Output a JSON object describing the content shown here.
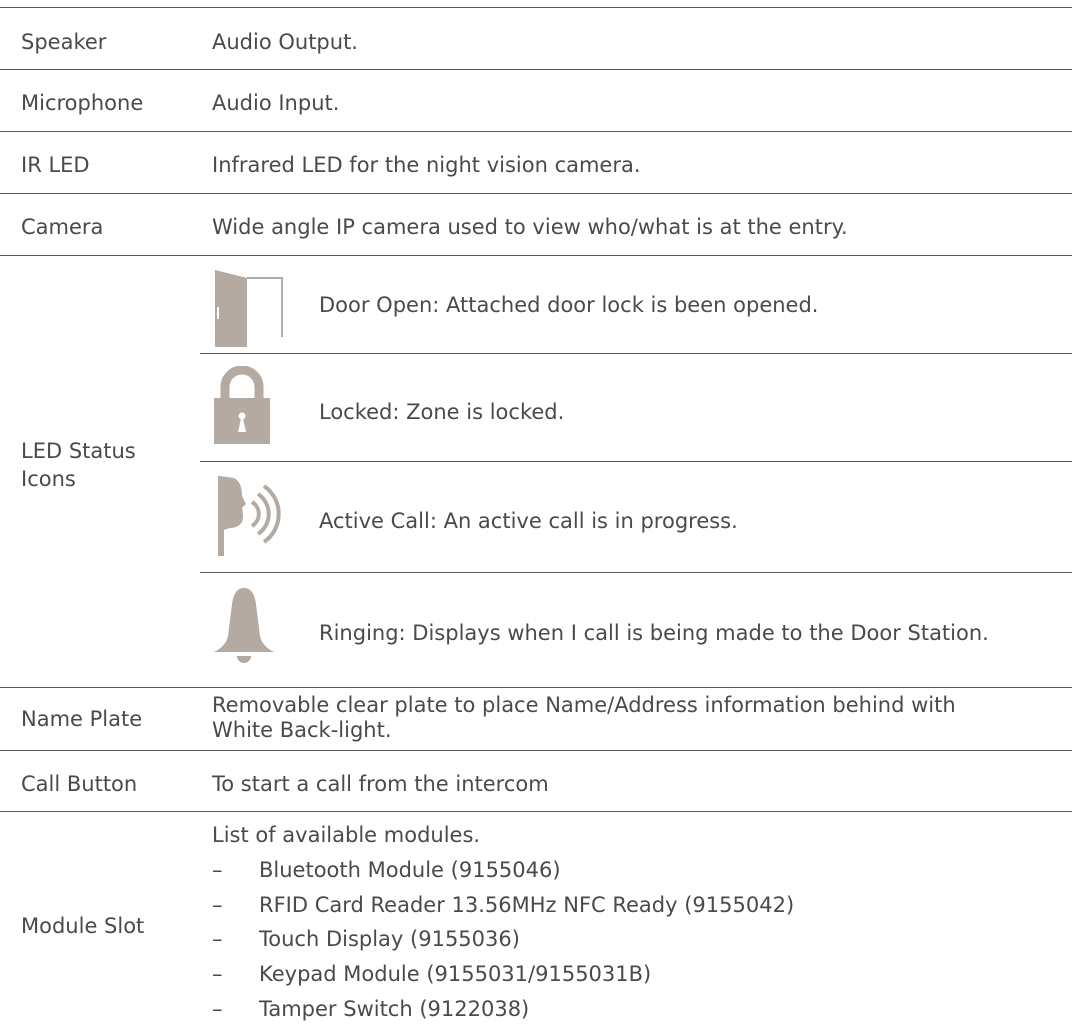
{
  "rows": [
    {
      "label": "Speaker",
      "desc": "Audio Output."
    },
    {
      "label": "Microphone",
      "desc": "Audio Input."
    },
    {
      "label": "IR LED",
      "desc": "Infrared LED for the night vision camera."
    },
    {
      "label": "Camera",
      "desc": "Wide angle IP camera used to view who/what is at the entry."
    }
  ],
  "led_status": {
    "label_line1": "LED Status",
    "label_line2": "Icons",
    "items": [
      {
        "icon": "door-open-icon",
        "desc": "Door Open: Attached door lock is been opened."
      },
      {
        "icon": "padlock-icon",
        "desc": "Locked: Zone is locked."
      },
      {
        "icon": "active-call-icon",
        "desc": "Active Call: An active call is in progress."
      },
      {
        "icon": "bell-icon",
        "desc": "Ringing: Displays when I call is being made to the Door Station."
      }
    ]
  },
  "name_plate": {
    "label": "Name Plate",
    "desc_line1": "Removable clear plate to place Name/Address information behind with",
    "desc_line2": "White Back-light."
  },
  "call_button": {
    "label": "Call Button",
    "desc": "To start a call from the intercom"
  },
  "module_slot": {
    "label": "Module Slot",
    "intro": "List of available modules.",
    "bullet": "–",
    "modules": [
      "Bluetooth Module (9155046)",
      "RFID Card Reader 13.56MHz NFC Ready (9155042)",
      "Touch Display (9155036)",
      "Keypad Module (9155031/9155031B)",
      "Tamper Switch (9122038)"
    ]
  },
  "colors": {
    "text": "#4a4a4a",
    "icon": "#b5aaa2",
    "rule": "#5a5a5a"
  }
}
